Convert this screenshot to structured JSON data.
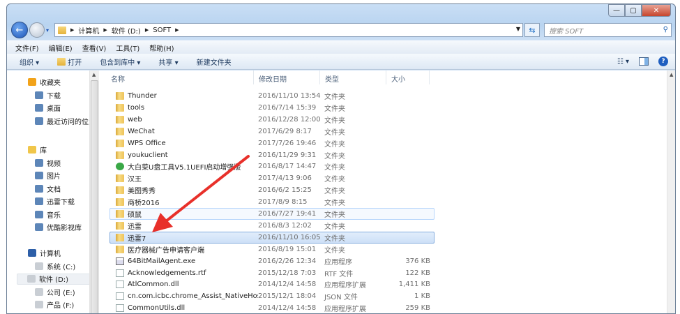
{
  "window": {
    "controls": {
      "minimize": "—",
      "maximize": "▢",
      "close": "✕"
    }
  },
  "address": {
    "crumbs": [
      "计算机",
      "软件 (D:)",
      "SOFT"
    ]
  },
  "search": {
    "placeholder": "搜索 SOFT"
  },
  "menu": [
    "文件(F)",
    "编辑(E)",
    "查看(V)",
    "工具(T)",
    "帮助(H)"
  ],
  "toolbar": {
    "organize": "组织 ▾",
    "open": "打开",
    "include": "包含到库中 ▾",
    "share": "共享 ▾",
    "new_folder": "新建文件夹",
    "help": "?",
    "views": "☷ ▾"
  },
  "sidebar": {
    "favorites": {
      "label": "收藏夹",
      "items": [
        "下载",
        "桌面",
        "最近访问的位置"
      ]
    },
    "libraries": {
      "label": "库",
      "items": [
        "视频",
        "图片",
        "文档",
        "迅雷下载",
        "音乐",
        "优酷影视库"
      ]
    },
    "computer": {
      "label": "计算机",
      "items": [
        "系统 (C:)",
        "软件 (D:)",
        "公司 (E:)",
        "产品 (F:)"
      ]
    }
  },
  "columns": [
    "名称",
    "修改日期",
    "类型",
    "大小"
  ],
  "files": [
    {
      "name": "Thunder",
      "date": "2016/11/10 13:54",
      "type": "文件夹",
      "size": "",
      "icon": "folder"
    },
    {
      "name": "tools",
      "date": "2016/7/14 15:39",
      "type": "文件夹",
      "size": "",
      "icon": "folder"
    },
    {
      "name": "web",
      "date": "2016/12/28 12:00",
      "type": "文件夹",
      "size": "",
      "icon": "folder"
    },
    {
      "name": "WeChat",
      "date": "2017/6/29 8:17",
      "type": "文件夹",
      "size": "",
      "icon": "folder"
    },
    {
      "name": "WPS Office",
      "date": "2017/7/26 19:46",
      "type": "文件夹",
      "size": "",
      "icon": "folder"
    },
    {
      "name": "youkuclient",
      "date": "2016/11/29 9:31",
      "type": "文件夹",
      "size": "",
      "icon": "folder"
    },
    {
      "name": "大白菜U盘工具V5.1UEFI启动增强版",
      "date": "2016/8/17 14:47",
      "type": "文件夹",
      "size": "",
      "icon": "app"
    },
    {
      "name": "汉王",
      "date": "2017/4/13 9:06",
      "type": "文件夹",
      "size": "",
      "icon": "folder"
    },
    {
      "name": "美图秀秀",
      "date": "2016/6/2 15:25",
      "type": "文件夹",
      "size": "",
      "icon": "folder"
    },
    {
      "name": "商桥2016",
      "date": "2017/8/9 8:15",
      "type": "文件夹",
      "size": "",
      "icon": "folder"
    },
    {
      "name": "硕鼠",
      "date": "2016/7/27 19:41",
      "type": "文件夹",
      "size": "",
      "icon": "folder",
      "state": "hover"
    },
    {
      "name": "迅雷",
      "date": "2016/8/3 12:02",
      "type": "文件夹",
      "size": "",
      "icon": "folder"
    },
    {
      "name": "迅雷7",
      "date": "2016/11/10 16:05",
      "type": "文件夹",
      "size": "",
      "icon": "folder",
      "state": "sel"
    },
    {
      "name": "医疗器械广告申请客户端",
      "date": "2016/8/19 15:01",
      "type": "文件夹",
      "size": "",
      "icon": "folder"
    },
    {
      "name": "64BitMailAgent.exe",
      "date": "2016/2/26 12:34",
      "type": "应用程序",
      "size": "376 KB",
      "icon": "exe"
    },
    {
      "name": "Acknowledgements.rtf",
      "date": "2015/12/18 7:03",
      "type": "RTF 文件",
      "size": "122 KB",
      "icon": "doc"
    },
    {
      "name": "AtlCommon.dll",
      "date": "2014/12/4 14:58",
      "type": "应用程序扩展",
      "size": "1,411 KB",
      "icon": "doc"
    },
    {
      "name": "cn.com.icbc.chrome_Assist_NativeHos...",
      "date": "2015/12/1 18:04",
      "type": "JSON 文件",
      "size": "1 KB",
      "icon": "doc"
    },
    {
      "name": "CommonUtils.dll",
      "date": "2014/12/4 14:58",
      "type": "应用程序扩展",
      "size": "259 KB",
      "icon": "doc"
    }
  ],
  "colors": {
    "annotation_arrow": "#e8302a",
    "selection": "#cde0f7"
  }
}
